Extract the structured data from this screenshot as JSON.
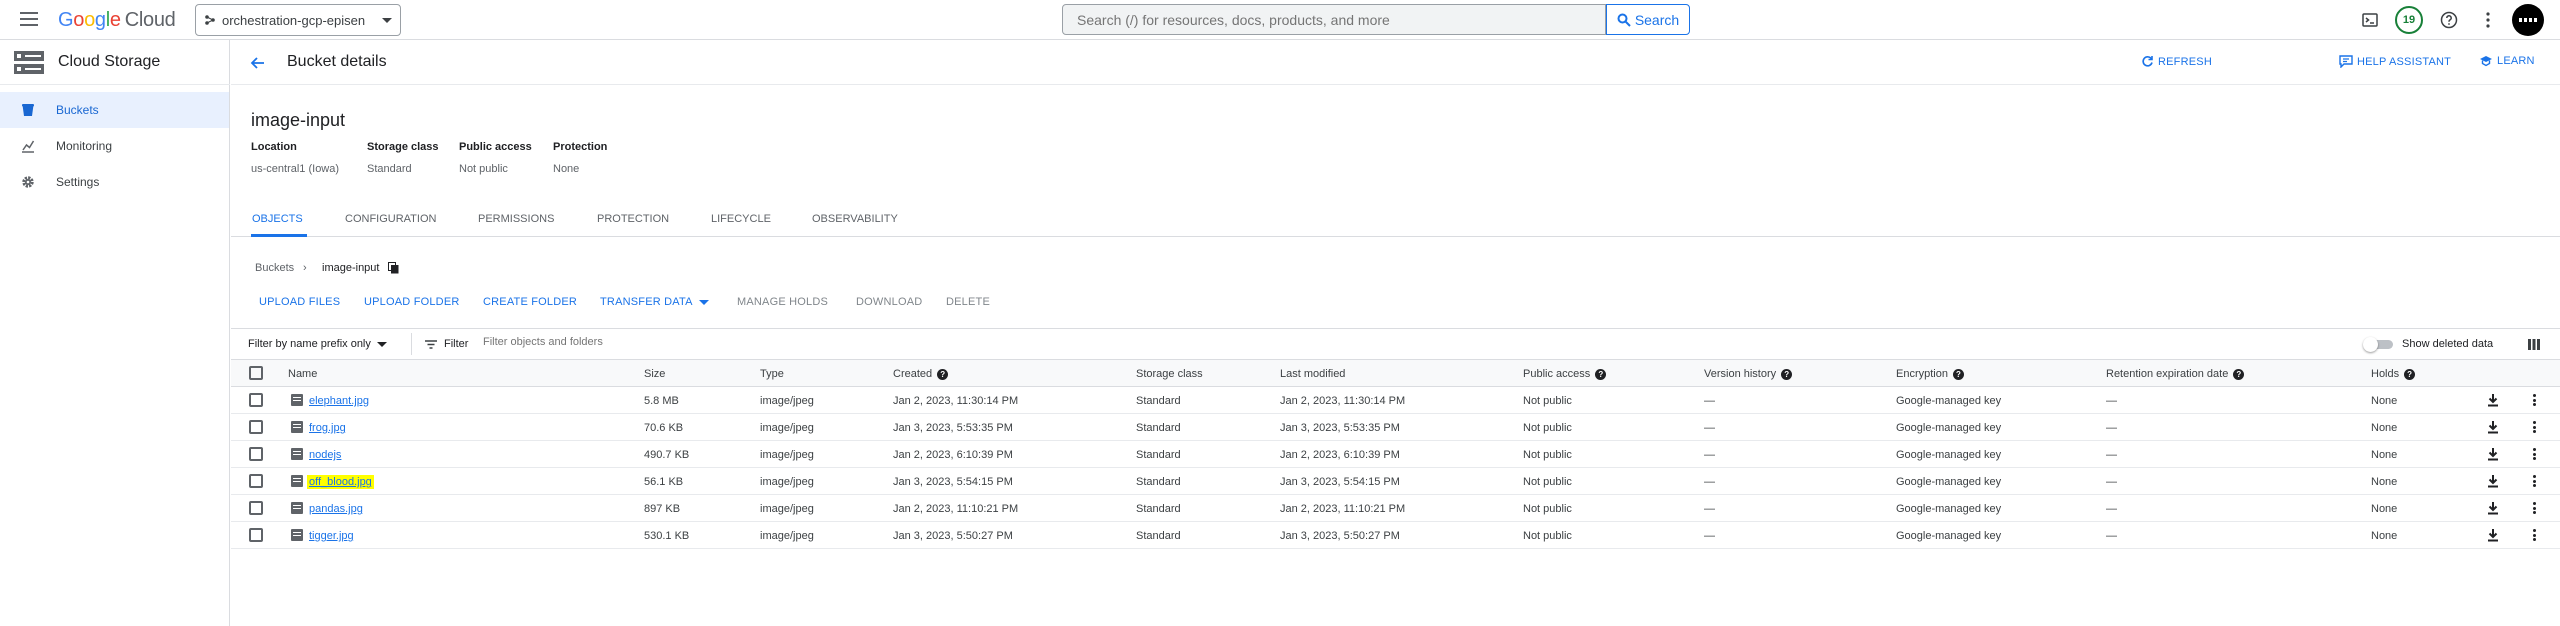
{
  "topbar": {
    "logo_letters": [
      "G",
      "o",
      "o",
      "g",
      "l",
      "e"
    ],
    "logo_product": "Cloud",
    "project": "orchestration-gcp-episen",
    "search_placeholder": "Search (/) for resources, docs, products, and more",
    "search_button": "Search",
    "notifications_count": "19"
  },
  "sidebar": {
    "title": "Cloud Storage",
    "items": [
      {
        "label": "Buckets",
        "icon": "bucket-icon"
      },
      {
        "label": "Monitoring",
        "icon": "monitoring-icon"
      },
      {
        "label": "Settings",
        "icon": "gear-icon"
      }
    ]
  },
  "header": {
    "title": "Bucket details",
    "actions": [
      "REFRESH",
      "HELP ASSISTANT",
      "LEARN"
    ]
  },
  "bucket": {
    "name": "image-input",
    "meta": [
      {
        "label": "Location",
        "value": "us-central1 (Iowa)"
      },
      {
        "label": "Storage class",
        "value": "Standard"
      },
      {
        "label": "Public access",
        "value": "Not public"
      },
      {
        "label": "Protection",
        "value": "None"
      }
    ]
  },
  "tabs": [
    "OBJECTS",
    "CONFIGURATION",
    "PERMISSIONS",
    "PROTECTION",
    "LIFECYCLE",
    "OBSERVABILITY"
  ],
  "breadcrumb": {
    "root": "Buckets",
    "current": "image-input"
  },
  "toolbar": {
    "upload_files": "UPLOAD FILES",
    "upload_folder": "UPLOAD FOLDER",
    "create_folder": "CREATE FOLDER",
    "transfer_data": "TRANSFER DATA",
    "manage_holds": "MANAGE HOLDS",
    "download": "DOWNLOAD",
    "delete": "DELETE"
  },
  "filter": {
    "prefix_select": "Filter by name prefix only",
    "filter_label": "Filter",
    "filter_placeholder": "Filter objects and folders",
    "show_deleted": "Show deleted data"
  },
  "table": {
    "columns": [
      "Name",
      "Size",
      "Type",
      "Created",
      "Storage class",
      "Last modified",
      "Public access",
      "Version history",
      "Encryption",
      "Retention expiration date",
      "Holds"
    ],
    "rows": [
      {
        "name": "elephant.jpg",
        "size": "5.8 MB",
        "type": "image/jpeg",
        "created": "Jan 2, 2023, 11:30:14 PM",
        "storage_class": "Standard",
        "modified": "Jan 2, 2023, 11:30:14 PM",
        "public": "Not public",
        "version": "—",
        "encryption": "Google-managed key",
        "retention": "—",
        "holds": "None"
      },
      {
        "name": "frog.jpg",
        "size": "70.6 KB",
        "type": "image/jpeg",
        "created": "Jan 3, 2023, 5:53:35 PM",
        "storage_class": "Standard",
        "modified": "Jan 3, 2023, 5:53:35 PM",
        "public": "Not public",
        "version": "—",
        "encryption": "Google-managed key",
        "retention": "—",
        "holds": "None"
      },
      {
        "name": "nodejs",
        "size": "490.7 KB",
        "type": "image/jpeg",
        "created": "Jan 2, 2023, 6:10:39 PM",
        "storage_class": "Standard",
        "modified": "Jan 2, 2023, 6:10:39 PM",
        "public": "Not public",
        "version": "—",
        "encryption": "Google-managed key",
        "retention": "—",
        "holds": "None"
      },
      {
        "name": "off_blood.jpg",
        "size": "56.1 KB",
        "type": "image/jpeg",
        "created": "Jan 3, 2023, 5:54:15 PM",
        "storage_class": "Standard",
        "modified": "Jan 3, 2023, 5:54:15 PM",
        "public": "Not public",
        "version": "—",
        "encryption": "Google-managed key",
        "retention": "—",
        "holds": "None"
      },
      {
        "name": "pandas.jpg",
        "size": "897 KB",
        "type": "image/jpeg",
        "created": "Jan 2, 2023, 11:10:21 PM",
        "storage_class": "Standard",
        "modified": "Jan 2, 2023, 11:10:21 PM",
        "public": "Not public",
        "version": "—",
        "encryption": "Google-managed key",
        "retention": "—",
        "holds": "None"
      },
      {
        "name": "tigger.jpg",
        "size": "530.1 KB",
        "type": "image/jpeg",
        "created": "Jan 3, 2023, 5:50:27 PM",
        "storage_class": "Standard",
        "modified": "Jan 3, 2023, 5:50:27 PM",
        "public": "Not public",
        "version": "—",
        "encryption": "Google-managed key",
        "retention": "—",
        "holds": "None"
      }
    ]
  },
  "colors": {
    "accent": "#1a73e8",
    "highlight": "#ffff00"
  }
}
